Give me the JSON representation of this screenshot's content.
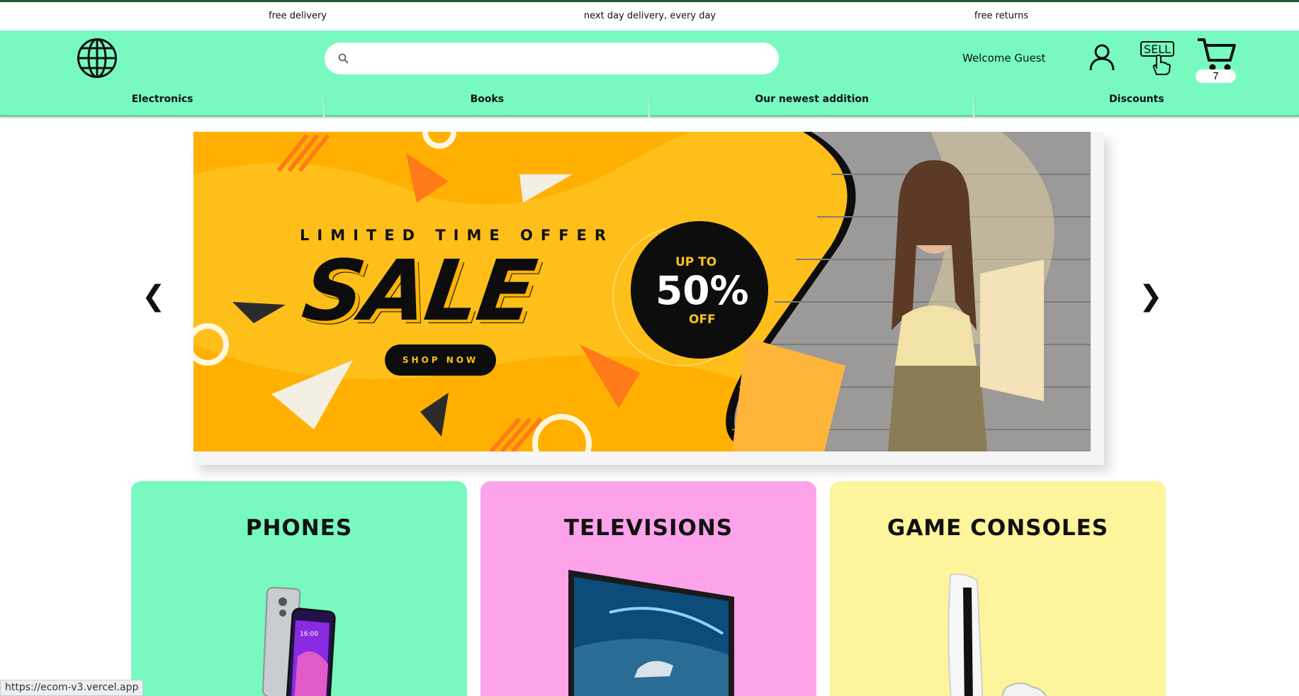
{
  "info_strip": {
    "left": "free delivery",
    "center": "next day delivery, every day",
    "right": "free returns"
  },
  "header": {
    "logo_icon": "globe-icon",
    "search": {
      "value": "",
      "placeholder": "",
      "icon": "search-icon"
    },
    "welcome_text": "Welcome Guest",
    "user_icon": "user-icon",
    "sell_icon": "sell-icon",
    "sell_label": "SELL",
    "cart_icon": "cart-icon",
    "cart_count": "7",
    "background_color": "#77f9c0"
  },
  "nav": {
    "items": [
      "Electronics",
      "Books",
      "Our newest addition",
      "Discounts"
    ]
  },
  "banner": {
    "prev_arrow": "❮",
    "next_arrow": "❯",
    "headline": "LIMITED TIME OFFER",
    "sale": "SALE",
    "cta": "SHOP NOW",
    "badge_top": "UP TO",
    "badge_value": "50%",
    "badge_bottom": "OFF",
    "colors": {
      "bg": "#ffbf1a",
      "accent": "#ff7a18",
      "dark": "#0d0d0d"
    }
  },
  "categories": [
    {
      "title": "PHONES",
      "color": "#77f9c0"
    },
    {
      "title": "TELEVISIONS",
      "color": "#fda3ea"
    },
    {
      "title": "GAME CONSOLES",
      "color": "#fef49b"
    }
  ],
  "status_bar": {
    "url": "https://ecom-v3.vercel.app"
  }
}
